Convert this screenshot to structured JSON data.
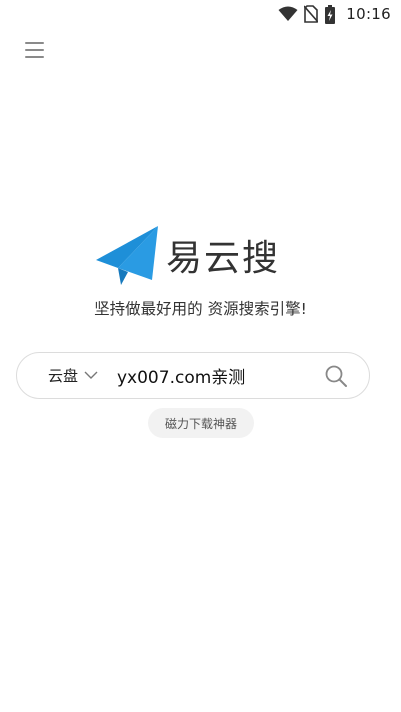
{
  "status_bar": {
    "time": "10:16",
    "icons": [
      "wifi-icon",
      "no-sim-icon",
      "battery-charging-icon"
    ]
  },
  "header": {
    "menu_icon": "hamburger-menu-icon"
  },
  "brand": {
    "logo_icon": "paper-plane-icon",
    "name": "易云搜",
    "slogan": "坚持做最好用的 资源搜索引擎!",
    "accent_color": "#1e8fd8"
  },
  "search": {
    "scope_label": "云盘",
    "query": "yx007.com亲测",
    "placeholder": ""
  },
  "chips": {
    "magnet_tool": "磁力下载神器"
  }
}
